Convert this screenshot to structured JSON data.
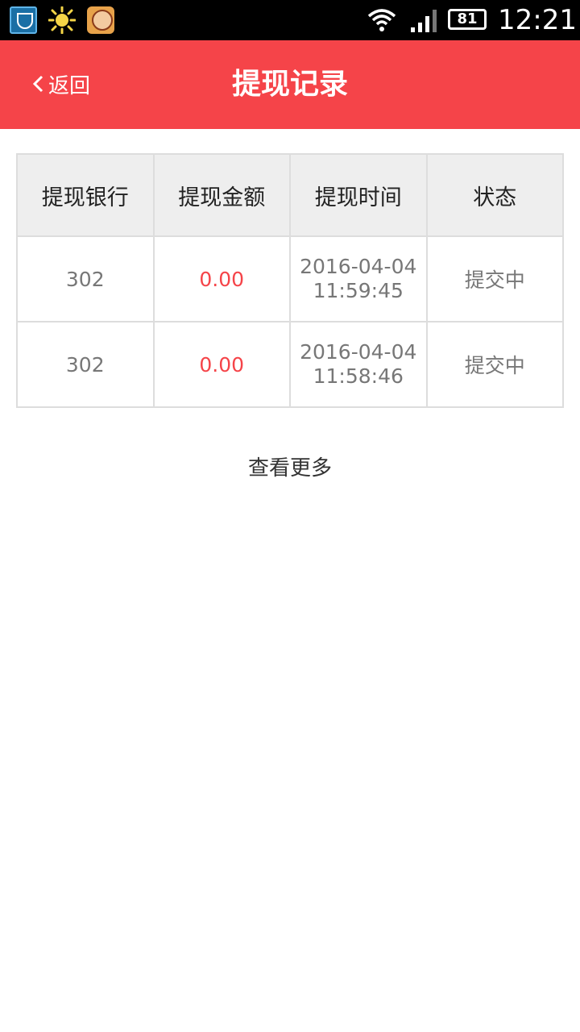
{
  "status_bar": {
    "battery": "81",
    "time": "12:21"
  },
  "header": {
    "back_label": "返回",
    "title": "提现记录"
  },
  "table": {
    "columns": [
      "提现银行",
      "提现金额",
      "提现时间",
      "状态"
    ],
    "rows": [
      {
        "bank": "302",
        "amount": "0.00",
        "date": "2016-04-04",
        "time": "11:59:45",
        "status": "提交中"
      },
      {
        "bank": "302",
        "amount": "0.00",
        "date": "2016-04-04",
        "time": "11:58:46",
        "status": "提交中"
      }
    ]
  },
  "more_label": "查看更多",
  "colors": {
    "accent": "#f54449",
    "amount": "#f54449",
    "header_bg": "#eeeeee",
    "border": "#dddddd"
  },
  "icons": {
    "status_bar": [
      "shield-app-icon",
      "sun-icon",
      "game-app-icon",
      "wifi-icon",
      "signal-icon",
      "battery-icon"
    ],
    "back": "chevron-left-icon"
  }
}
